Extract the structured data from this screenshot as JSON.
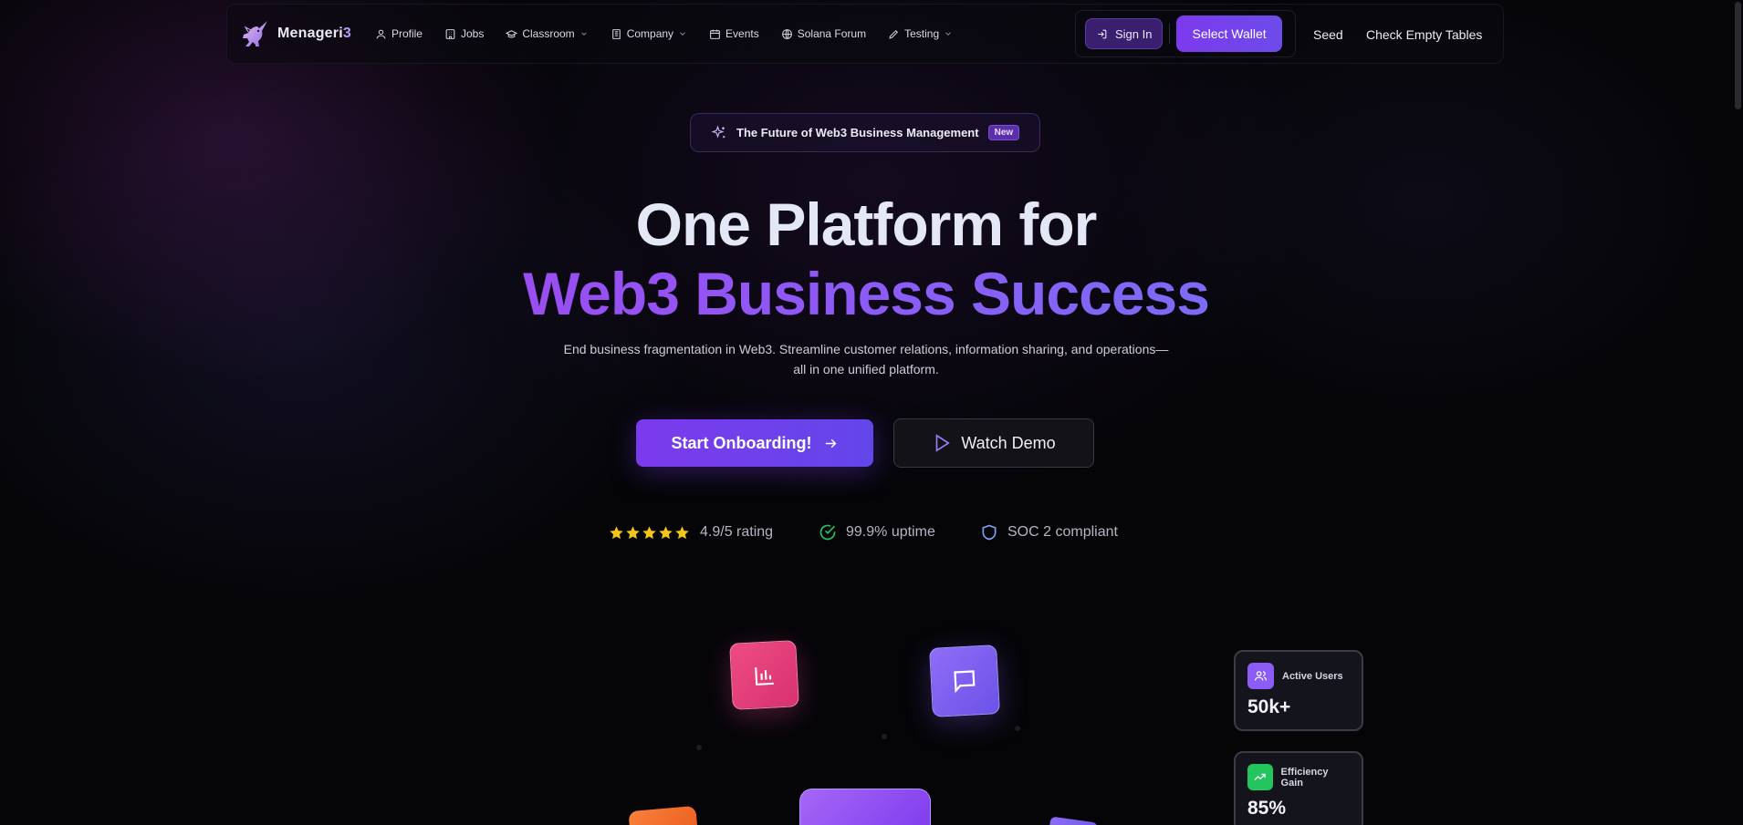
{
  "brand": {
    "name_main": "Menageri",
    "name_accent": "3"
  },
  "nav": {
    "links": [
      {
        "label": "Profile",
        "icon": "user-icon"
      },
      {
        "label": "Jobs",
        "icon": "building-icon"
      },
      {
        "label": "Classroom",
        "icon": "graduation-cap-icon",
        "dropdown": true
      },
      {
        "label": "Company",
        "icon": "office-icon",
        "dropdown": true
      },
      {
        "label": "Events",
        "icon": "calendar-icon"
      },
      {
        "label": "Solana Forum",
        "icon": "globe-icon"
      },
      {
        "label": "Testing",
        "icon": "pen-icon",
        "dropdown": true
      }
    ],
    "sign_in": "Sign In",
    "select_wallet": "Select Wallet",
    "seed": "Seed",
    "check_empty_tables": "Check Empty Tables"
  },
  "hero": {
    "badge_text": "The Future of Web3 Business Management",
    "badge_new": "New",
    "title_line1": "One Platform for",
    "title_line2": "Web3 Business Success",
    "subtitle_line1": "End business fragmentation in Web3. Streamline customer relations, information sharing, and operations—",
    "subtitle_line2": "all in one unified platform.",
    "cta_primary": "Start Onboarding!",
    "cta_secondary": "Watch Demo"
  },
  "trust": {
    "rating_stars": 5,
    "rating": "4.9/5 rating",
    "uptime": "99.9% uptime",
    "compliance": "SOC 2 compliant"
  },
  "stats": [
    {
      "label": "Active Users",
      "value": "50k+",
      "icon": "users-icon",
      "color": "#8b5cf6"
    },
    {
      "label": "Efficiency Gain",
      "value": "85%",
      "icon": "trending-up-icon",
      "color": "#22c55e"
    }
  ],
  "colors": {
    "accent": "#7c3aed",
    "background": "#050508",
    "star": "#f5c518",
    "uptime_check": "#22c55e",
    "shield": "#7ea2f2",
    "tile_pink": "#e63e79",
    "tile_purple": "#7c5cf0",
    "tile_orange": "#f16f2b"
  }
}
